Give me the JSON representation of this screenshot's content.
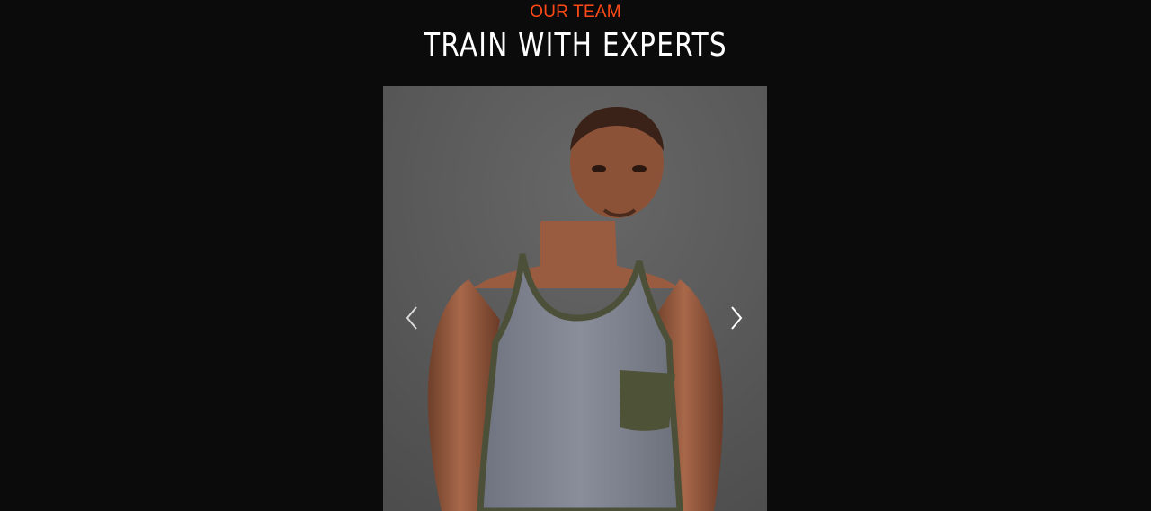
{
  "section": {
    "eyebrow": "OUR TEAM",
    "title": "TRAIN WITH EXPERTS"
  },
  "slider": {
    "slide": {
      "image": "trainer-photo"
    },
    "prev_icon": "chevron-left-icon",
    "next_icon": "chevron-right-icon"
  },
  "colors": {
    "background": "#0b0b0b",
    "accent": "#ff4a17",
    "title": "#ffffff",
    "photo_backdrop": "#5b5b5b"
  }
}
